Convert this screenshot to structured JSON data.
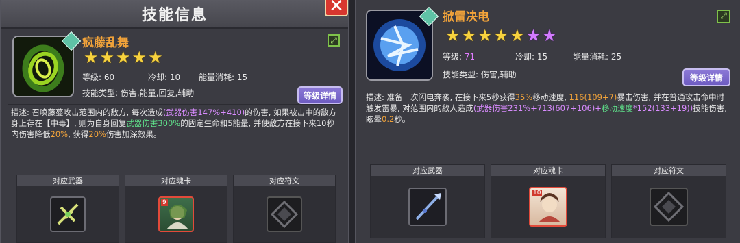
{
  "left": {
    "title": "技能信息",
    "close_label": "✕",
    "skill": {
      "name": "疯藤乱舞",
      "stars": 5,
      "purple_stars": 0,
      "level_label": "等级:",
      "level_value": "60",
      "cooldown_label": "冷却:",
      "cooldown_value": "10",
      "energy_label": "能量消耗:",
      "energy_value": "15",
      "type_text": "技能类型: 伤害,能量,回复,辅助",
      "detail_button": "等级详情"
    },
    "description": {
      "p1": "描述: 召唤藤蔓攻击范围内的敌方, 每次造成",
      "p2": "(武器伤害147%+410)",
      "p3": "的伤害, 如果被击中的敌方身上存在【中毒】, 则为自身回复",
      "p4": "武器伤害300%",
      "p5": "的固定生命和5能量, 并使敌方在接下来10秒内伤害降低",
      "p6": "20%",
      "p7": ", 获得",
      "p8": "20%",
      "p9": "伤害加深效果。"
    },
    "slots": [
      {
        "label": "对应武器"
      },
      {
        "label": "对应魂卡",
        "card_level": "9"
      },
      {
        "label": "对应符文"
      }
    ]
  },
  "right": {
    "skill": {
      "name": "掀雷决电",
      "stars": 5,
      "purple_stars": 2,
      "level_label": "等级:",
      "level_value": "71",
      "cooldown_label": "冷却:",
      "cooldown_value": "15",
      "energy_label": "能量消耗:",
      "energy_value": "25",
      "type_text": "技能类型: 伤害,辅助",
      "detail_button": "等级详情"
    },
    "description": {
      "p1": "描述: 准备一次闪电奔袭, 在接下来5秒获得",
      "p2": "35%",
      "p3": "移动速度, ",
      "p4": "116(109+7)",
      "p5": "暴击伤害, 并在普通攻击命中时触发雷暴, 对范围内的敌人造成",
      "p6": "(武器伤害231%+713(607+106)+",
      "p7": "移动速度",
      "p8": "*152(133+19))",
      "p9": "技能伤害, 眩晕",
      "p10": "0.2",
      "p11": "秒。"
    },
    "slots": [
      {
        "label": "对应武器"
      },
      {
        "label": "对应魂卡",
        "card_level": "10"
      },
      {
        "label": "对应符文"
      }
    ]
  }
}
